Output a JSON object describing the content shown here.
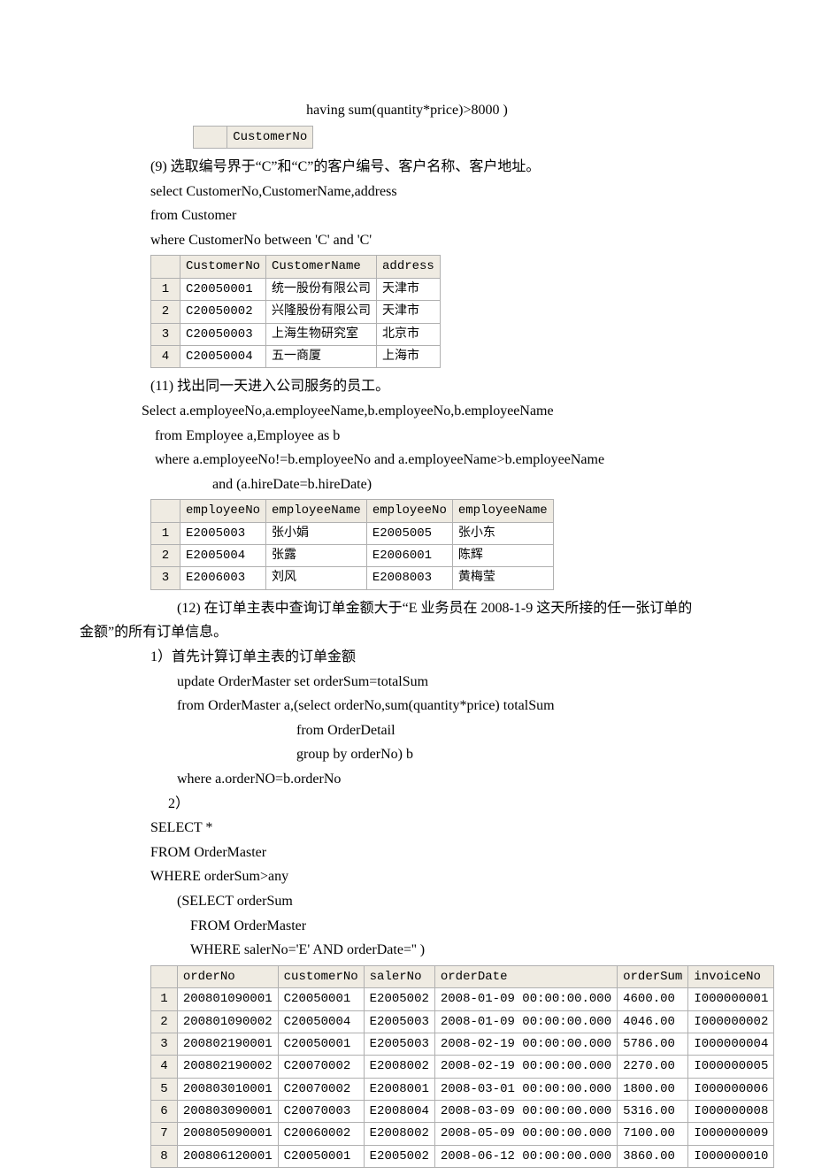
{
  "line_having": "having sum(quantity*price)>8000 )",
  "mini_table_header": "CustomerNo",
  "q9_title": "(9) 选取编号界于“C”和“C”的客户编号、客户名称、客户地址。",
  "q9_sql1": "select CustomerNo,CustomerName,address",
  "q9_sql2": "from Customer",
  "q9_sql3": "where CustomerNo between 'C' and 'C'",
  "t1_headers": [
    "",
    "CustomerNo",
    "CustomerName",
    "address"
  ],
  "t1_rows": [
    [
      "1",
      "C20050001",
      "统一股份有限公司",
      "天津市"
    ],
    [
      "2",
      "C20050002",
      "兴隆股份有限公司",
      "天津市"
    ],
    [
      "3",
      "C20050003",
      "上海生物研究室",
      "北京市"
    ],
    [
      "4",
      "C20050004",
      "五一商厦",
      "上海市"
    ]
  ],
  "q11_title": "(11) 找出同一天进入公司服务的员工。",
  "q11_sql1": "Select a.employeeNo,a.employeeName,b.employeeNo,b.employeeName",
  "q11_sql2": "from Employee a,Employee as b",
  "q11_sql3": "where a.employeeNo!=b.employeeNo and a.employeeName>b.employeeName",
  "q11_sql4": "and (a.hireDate=b.hireDate)",
  "t2_headers": [
    "",
    "employeeNo",
    "employeeName",
    "employeeNo",
    "employeeName"
  ],
  "t2_rows": [
    [
      "1",
      "E2005003",
      "张小娟",
      "E2005005",
      "张小东"
    ],
    [
      "2",
      "E2005004",
      "张露",
      "E2006001",
      "陈辉"
    ],
    [
      "3",
      "E2006003",
      "刘风",
      "E2008003",
      "黄梅莹"
    ]
  ],
  "q12_title_a": "(12) 在订单主表中查询订单金额大于“E 业务员在 2008-1-9 这天所接的任一张订单的",
  "q12_title_b": "金额”的所有订单信息。",
  "q12_step1": "1）首先计算订单主表的订单金额",
  "q12_u1": "update OrderMaster set orderSum=totalSum",
  "q12_u2": "from OrderMaster a,(select orderNo,sum(quantity*price) totalSum",
  "q12_u3": "from OrderDetail",
  "q12_u4": "group by orderNo) b",
  "q12_u5": "where a.orderNO=b.orderNo",
  "q12_step2": "2）",
  "q12_s1": "SELECT *",
  "q12_s2": "FROM OrderMaster",
  "q12_s3": "WHERE orderSum>any",
  "q12_s4": "(SELECT orderSum",
  "q12_s5": "FROM OrderMaster",
  "q12_s6": "WHERE salerNo='E' AND orderDate='' )",
  "t3_headers": [
    "",
    "orderNo",
    "customerNo",
    "salerNo",
    "orderDate",
    "orderSum",
    "invoiceNo"
  ],
  "t3_rows": [
    [
      "1",
      "200801090001",
      "C20050001",
      "E2005002",
      "2008-01-09 00:00:00.000",
      "4600.00",
      "I000000001"
    ],
    [
      "2",
      "200801090002",
      "C20050004",
      "E2005003",
      "2008-01-09 00:00:00.000",
      "4046.00",
      "I000000002"
    ],
    [
      "3",
      "200802190001",
      "C20050001",
      "E2005003",
      "2008-02-19 00:00:00.000",
      "5786.00",
      "I000000004"
    ],
    [
      "4",
      "200802190002",
      "C20070002",
      "E2008002",
      "2008-02-19 00:00:00.000",
      "2270.00",
      "I000000005"
    ],
    [
      "5",
      "200803010001",
      "C20070002",
      "E2008001",
      "2008-03-01 00:00:00.000",
      "1800.00",
      "I000000006"
    ],
    [
      "6",
      "200803090001",
      "C20070003",
      "E2008004",
      "2008-03-09 00:00:00.000",
      "5316.00",
      "I000000008"
    ],
    [
      "7",
      "200805090001",
      "C20060002",
      "E2008002",
      "2008-05-09 00:00:00.000",
      "7100.00",
      "I000000009"
    ],
    [
      "8",
      "200806120001",
      "C20050001",
      "E2005002",
      "2008-06-12 00:00:00.000",
      "3860.00",
      "I000000010"
    ]
  ]
}
